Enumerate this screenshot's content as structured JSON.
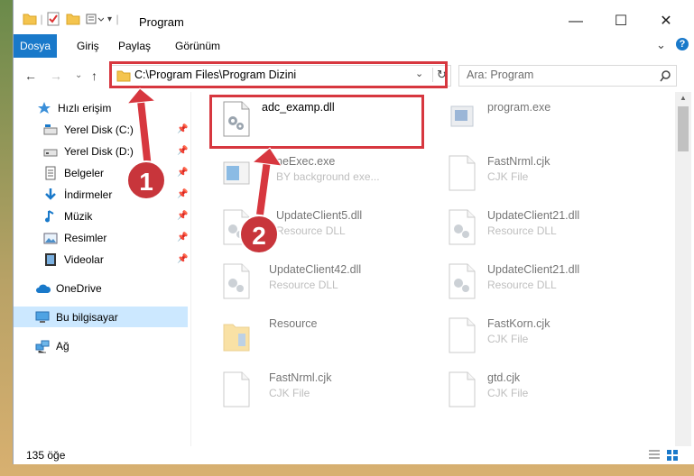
{
  "window": {
    "title": "Program",
    "minimize": "—",
    "maximize": "☐",
    "close": "✕"
  },
  "ribbon": {
    "tabs": [
      "Dosya",
      "Giriş",
      "Paylaş",
      "Görünüm"
    ],
    "help": "?"
  },
  "address": {
    "path": "C:\\Program Files\\Program Dizini",
    "search_placeholder": "Ara: Program"
  },
  "nav": {
    "items": [
      {
        "label": "Hızlı erişim",
        "icon": "star-icon",
        "pinned": false
      },
      {
        "label": "Yerel Disk (C:)",
        "icon": "drive-icon",
        "pinned": true
      },
      {
        "label": "Yerel Disk (D:)",
        "icon": "drive-icon",
        "pinned": true
      },
      {
        "label": "Belgeler",
        "icon": "documents-icon",
        "pinned": true
      },
      {
        "label": "İndirmeler",
        "icon": "download-icon",
        "pinned": true
      },
      {
        "label": "Müzik",
        "icon": "music-icon",
        "pinned": true
      },
      {
        "label": "Resimler",
        "icon": "pictures-icon",
        "pinned": true
      },
      {
        "label": "Videolar",
        "icon": "videos-icon",
        "pinned": true
      },
      {
        "label": "OneDrive",
        "icon": "cloud-icon",
        "pinned": false
      },
      {
        "label": "Bu bilgisayar",
        "icon": "computer-icon",
        "pinned": false
      },
      {
        "label": "Ağ",
        "icon": "network-icon",
        "pinned": false
      }
    ]
  },
  "files": [
    {
      "name": "adc_examp.dll",
      "desc": "",
      "icon": "dll-gear-icon"
    },
    {
      "name": "program.exe",
      "desc": "",
      "icon": "exe-icon"
    },
    {
      "name": "neExec.exe",
      "desc": "BY background exe...",
      "icon": "exe-window-icon"
    },
    {
      "name": "FastNrml.cjk",
      "desc": "CJK File",
      "icon": "blank-file-icon"
    },
    {
      "name": "UpdateClient5.dll",
      "desc": "Resource DLL",
      "icon": "dll-gear-icon"
    },
    {
      "name": "UpdateClient21.dll",
      "desc": "Resource DLL",
      "icon": "dll-gear-icon"
    },
    {
      "name": "UpdateClient42.dll",
      "desc": "Resource DLL",
      "icon": "dll-gear-icon"
    },
    {
      "name": "UpdateClient21.dll",
      "desc": "Resource DLL",
      "icon": "dll-gear-icon"
    },
    {
      "name": "Resource",
      "desc": "",
      "icon": "folder-icon"
    },
    {
      "name": "FastKorn.cjk",
      "desc": "CJK File",
      "icon": "blank-file-icon"
    },
    {
      "name": "FastNrml.cjk",
      "desc": "CJK File",
      "icon": "blank-file-icon"
    },
    {
      "name": "gtd.cjk",
      "desc": "CJK File",
      "icon": "blank-file-icon"
    }
  ],
  "status": {
    "count": "135 öğe"
  },
  "callouts": [
    "1",
    "2"
  ],
  "colors": {
    "accent": "#1979ca",
    "highlight": "#d7373f",
    "selection": "#cce8ff"
  }
}
